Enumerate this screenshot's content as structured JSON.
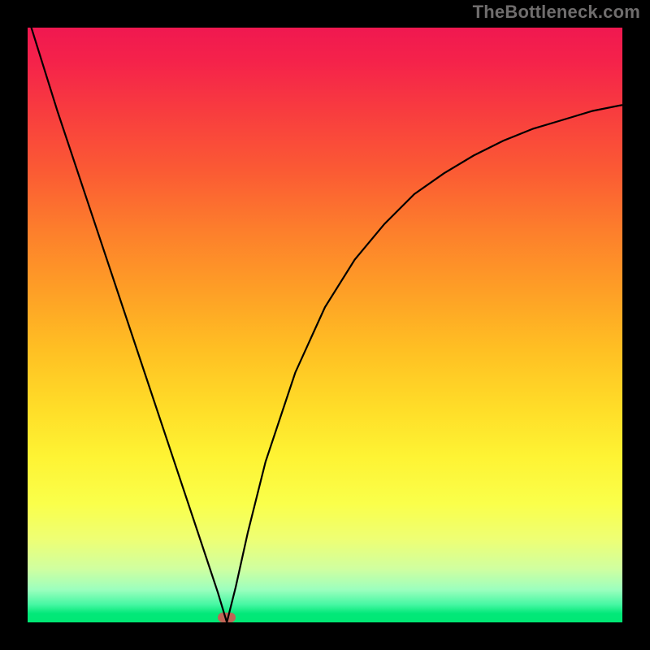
{
  "watermark": "TheBottleneck.com",
  "marker": {
    "x_pct": 33.5,
    "y_pct": 99.2
  },
  "chart_data": {
    "type": "line",
    "title": "",
    "xlabel": "",
    "ylabel": "",
    "xlim": [
      0,
      100
    ],
    "ylim": [
      0,
      100
    ],
    "grid": false,
    "legend": false,
    "annotations": [
      "TheBottleneck.com"
    ],
    "series": [
      {
        "name": "bottleneck-curve",
        "x": [
          0,
          5,
          10,
          15,
          20,
          25,
          28,
          30,
          32,
          33.5,
          35,
          37,
          40,
          45,
          50,
          55,
          60,
          65,
          70,
          75,
          80,
          85,
          90,
          95,
          100
        ],
        "y": [
          102,
          86,
          71,
          56,
          41,
          26,
          17,
          11,
          5,
          0,
          6,
          15,
          27,
          42,
          53,
          61,
          67,
          72,
          75.5,
          78.5,
          81,
          83,
          84.5,
          86,
          87
        ]
      }
    ],
    "background_gradient": {
      "top": "#f01850",
      "upper_mid": "#ffbf23",
      "lower_mid": "#fef333",
      "bottom": "#00e874"
    },
    "marker": {
      "x": 33.5,
      "y": 0,
      "color": "#c06355",
      "shape": "pill"
    }
  }
}
